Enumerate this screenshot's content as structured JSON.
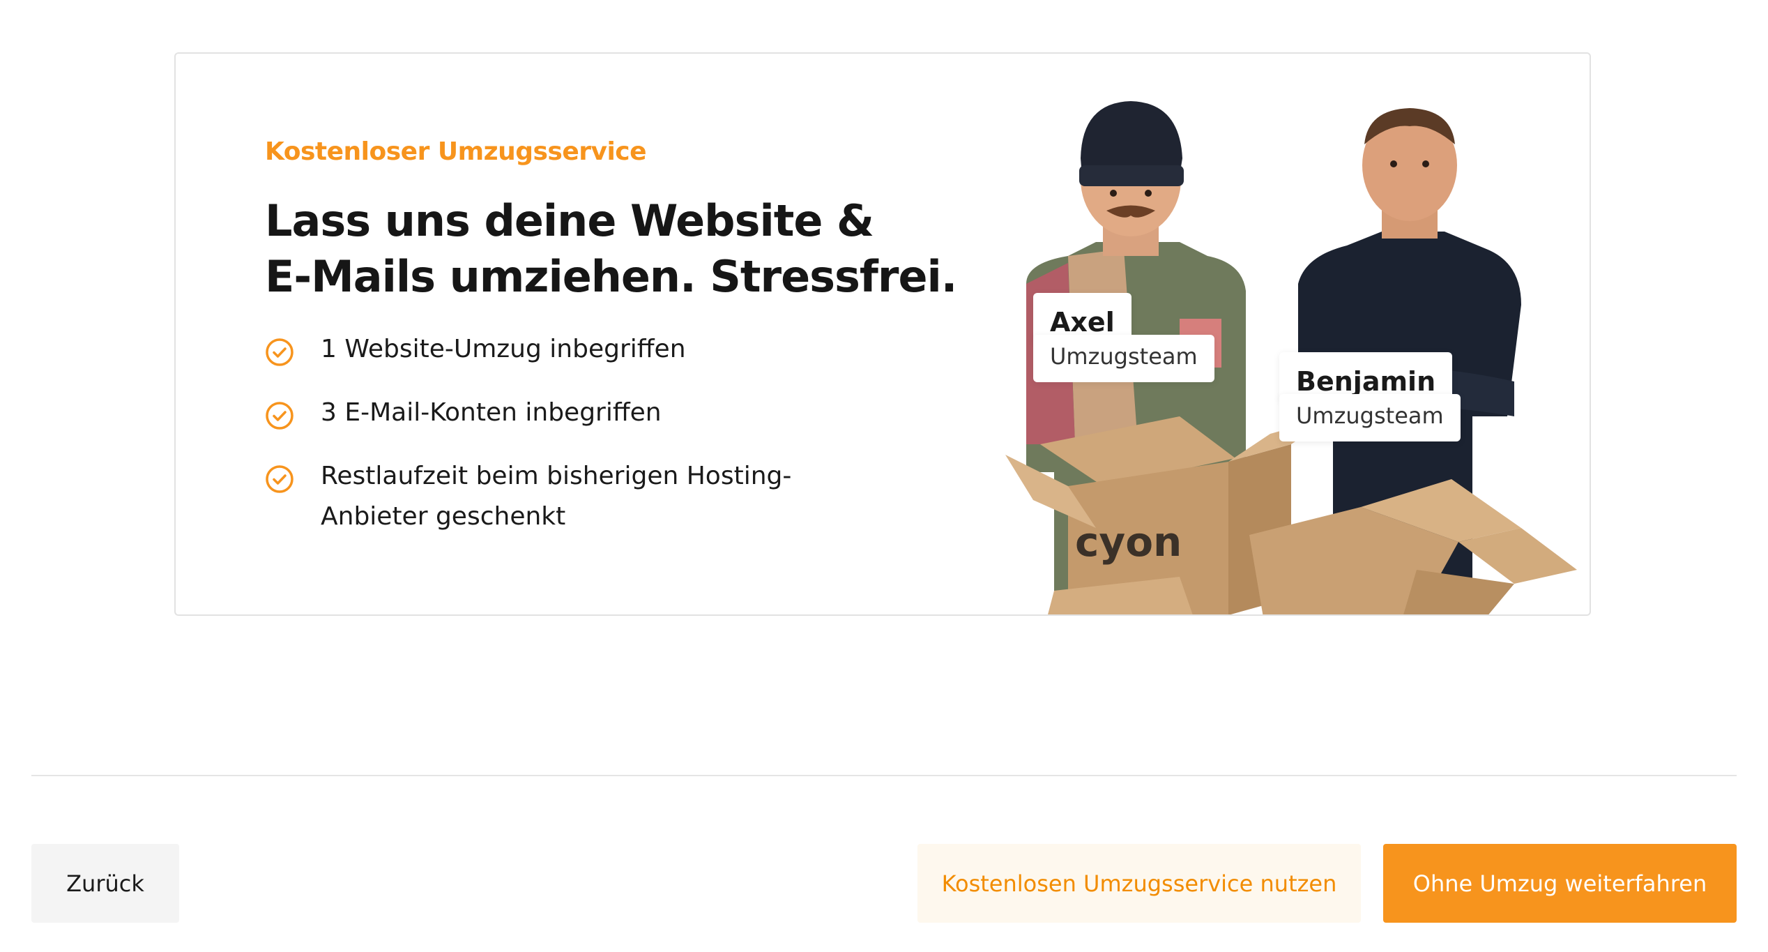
{
  "promo": {
    "eyebrow": "Kostenloser Umzugsservice",
    "headline_line1": "Lass uns deine Website &",
    "headline_line2": "E-Mails umziehen. Stressfrei.",
    "features": [
      {
        "text": "1 Website-Umzug inbegriffen",
        "icon": "check-circle-icon"
      },
      {
        "text": "3 E-Mail-Konten inbegriffen",
        "icon": "check-circle-icon"
      },
      {
        "text": "Restlaufzeit beim bisherigen Hosting-Anbieter geschenkt",
        "icon": "check-circle-icon"
      }
    ],
    "team": [
      {
        "name": "Axel",
        "role": "Umzugsteam"
      },
      {
        "name": "Benjamin",
        "role": "Umzugsteam"
      }
    ],
    "box_logo": "cyon"
  },
  "footer": {
    "back_label": "Zurück",
    "service_label": "Kostenlosen Umzugsservice nutzen",
    "continue_label": "Ohne Umzug weiterfahren"
  },
  "colors": {
    "accent": "#f7941d",
    "accent_light": "#fef8ee",
    "text": "#1a1a1a",
    "neutral_button": "#f4f4f4"
  }
}
